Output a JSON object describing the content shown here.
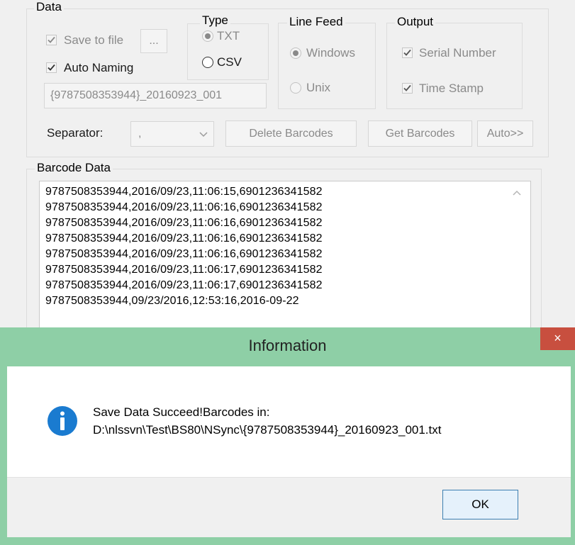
{
  "data_group": {
    "legend": "Data",
    "save_to_file": {
      "label": "Save to file",
      "checked": true
    },
    "browse_label": "...",
    "auto_naming": {
      "label": "Auto Naming",
      "checked": true
    },
    "file_name": "{9787508353944}_20160923_001"
  },
  "type_group": {
    "legend": "Type",
    "options": [
      {
        "label": "TXT",
        "selected": true
      },
      {
        "label": "CSV",
        "selected": false
      }
    ]
  },
  "line_feed_group": {
    "legend": "Line Feed",
    "options": [
      {
        "label": "Windows",
        "selected": true
      },
      {
        "label": "Unix",
        "selected": false
      }
    ]
  },
  "output_group": {
    "legend": "Output",
    "serial_number": {
      "label": "Serial Number",
      "checked": true
    },
    "time_stamp": {
      "label": "Time Stamp",
      "checked": true
    }
  },
  "separator": {
    "label": "Separator:",
    "value": ","
  },
  "buttons": {
    "delete_barcodes": "Delete Barcodes",
    "get_barcodes": "Get Barcodes",
    "auto": "Auto>>"
  },
  "barcode_data": {
    "legend": "Barcode Data",
    "rows": [
      "9787508353944,2016/09/23,11:06:15,6901236341582",
      "9787508353944,2016/09/23,11:06:16,6901236341582",
      "9787508353944,2016/09/23,11:06:16,6901236341582",
      "9787508353944,2016/09/23,11:06:16,6901236341582",
      "9787508353944,2016/09/23,11:06:16,6901236341582",
      "9787508353944,2016/09/23,11:06:17,6901236341582",
      "9787508353944,2016/09/23,11:06:17,6901236341582",
      "9787508353944,09/23/2016,12:53:16,2016-09-22"
    ]
  },
  "dialog": {
    "title": "Information",
    "close_glyph": "×",
    "icon": "info-icon",
    "message_line1": "Save Data Succeed!Barcodes in:",
    "message_line2": "D:\\nlssvn\\Test\\BS80\\NSync\\{9787508353944}_20160923_001.txt",
    "ok_label": "OK"
  },
  "colors": {
    "dialog_frame": "#8ecfa6",
    "close_button": "#c84f3f",
    "info_icon": "#1a7bd0",
    "ok_border": "#3c7fb1"
  }
}
